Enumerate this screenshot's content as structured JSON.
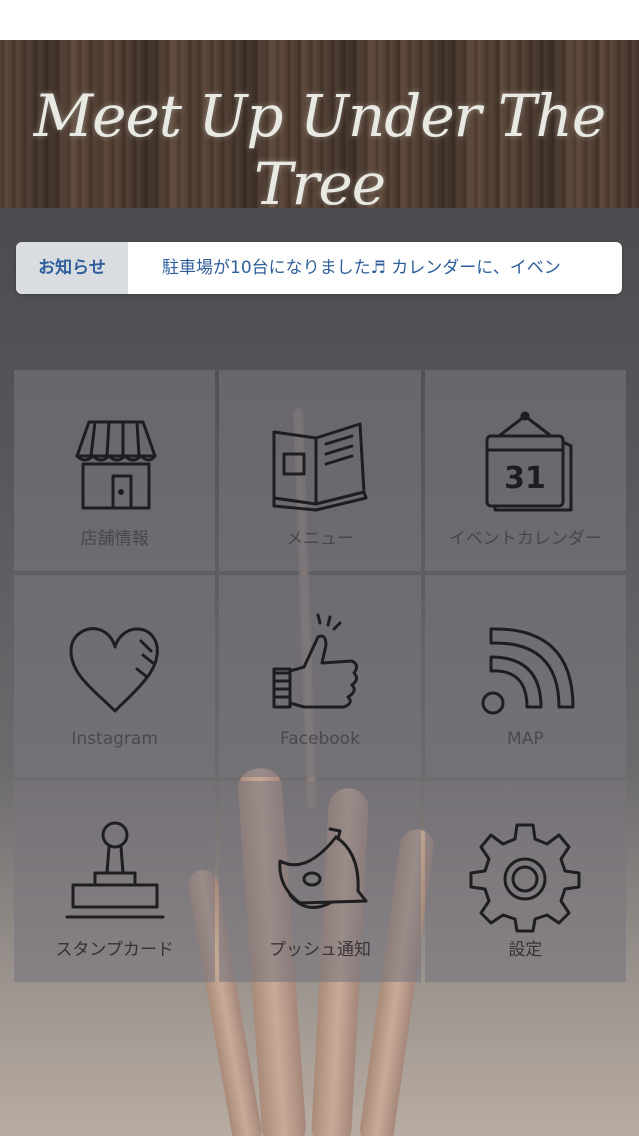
{
  "header": {
    "title": "Meet Up Under The Tree"
  },
  "notice": {
    "label": "お知らせ",
    "text": "駐車場が10台になりました♬ カレンダーに、イベン"
  },
  "menu": {
    "items": [
      {
        "label": "店舗情報",
        "icon": "shop-icon"
      },
      {
        "label": "メニュー",
        "icon": "book-icon"
      },
      {
        "label": "イベントカレンダー",
        "icon": "calendar-icon",
        "date": "31"
      },
      {
        "label": "Instagram",
        "icon": "heart-icon"
      },
      {
        "label": "Facebook",
        "icon": "thumbs-up-icon"
      },
      {
        "label": "MAP",
        "icon": "signal-icon"
      },
      {
        "label": "スタンプカード",
        "icon": "stamp-icon"
      },
      {
        "label": "プッシュ通知",
        "icon": "bell-icon"
      },
      {
        "label": "設定",
        "icon": "gear-icon"
      }
    ]
  }
}
